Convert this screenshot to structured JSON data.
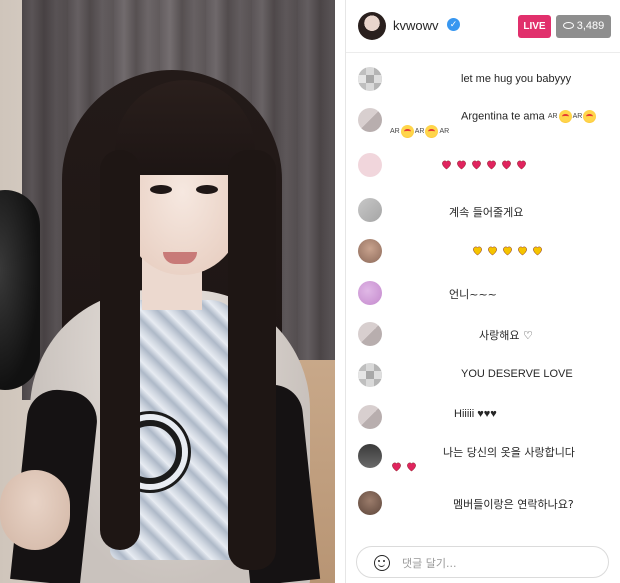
{
  "header": {
    "username": "kvwowv",
    "verified_icon": "verified-check-icon",
    "live_label": "LIVE",
    "viewer_count": "3,489",
    "viewer_icon": "eye-icon"
  },
  "comments": [
    {
      "text": "let me hug you babyyy"
    },
    {
      "text": "Argentina te ama",
      "suffix": "AR",
      "line2": [
        "AR",
        "AR",
        "AR"
      ]
    },
    {
      "text": "",
      "hearts": 6,
      "heart_color": "#e0245e"
    },
    {
      "text": "계속 들어줄게요"
    },
    {
      "text": "",
      "hearts": 5,
      "heart_color": "#f5c400"
    },
    {
      "text": "언니~~~"
    },
    {
      "text": "사랑해요 ♡"
    },
    {
      "text": "YOU DESERVE LOVE"
    },
    {
      "text": "Hiiiii ♥♥♥"
    },
    {
      "text": "나는 당신의 옷을 사랑합니다",
      "hearts_line2": 2,
      "heart_color": "#e0245e"
    },
    {
      "text": "멤버들이랑은 연락하나요?"
    }
  ],
  "footer": {
    "placeholder": "댓글 달기...",
    "emoji_icon": "smiley-icon"
  },
  "colors": {
    "live": "#e1306c",
    "verified": "#3897f0",
    "viewers_bg": "#8e8e8e"
  }
}
